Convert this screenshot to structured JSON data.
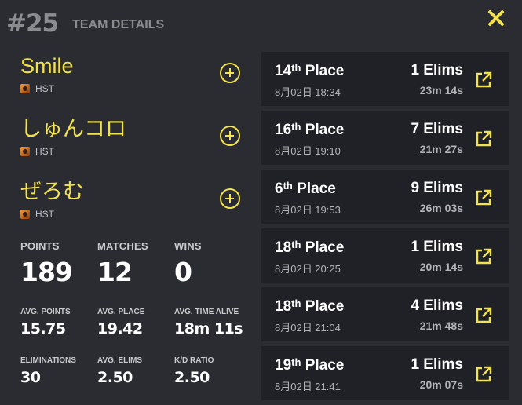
{
  "header": {
    "rank": "#25",
    "title": "TEAM DETAILS"
  },
  "colors": {
    "accent": "#f3e24f",
    "background": "#2a2c31",
    "card": "#1f2126",
    "muted": "#8a8c90"
  },
  "players": [
    {
      "name": "Smile",
      "tag": "HST",
      "tag_icon": "team-logo-icon"
    },
    {
      "name": "しゅんコロ",
      "tag": "HST",
      "tag_icon": "team-logo-icon"
    },
    {
      "name": "ぜろむ",
      "tag": "HST",
      "tag_icon": "team-logo-icon"
    }
  ],
  "stats": {
    "points_label": "POINTS",
    "points": "189",
    "matches_label": "MATCHES",
    "matches": "12",
    "wins_label": "WINS",
    "wins": "0",
    "avg_points_label": "AVG. POINTS",
    "avg_points": "15.75",
    "avg_place_label": "AVG. PLACE",
    "avg_place": "19.42",
    "avg_time_label": "AVG. TIME ALIVE",
    "avg_time": "18m 11s",
    "elims_label": "ELIMINATIONS",
    "elims": "30",
    "avg_elims_label": "AVG. ELIMS",
    "avg_elims": "2.50",
    "kd_label": "K/D RATIO",
    "kd": "2.50"
  },
  "matches": [
    {
      "place_num": "14",
      "place_suffix": "th",
      "place_word": "Place",
      "date": "8月02日 18:34",
      "elims": "1 Elims",
      "time": "23m 14s"
    },
    {
      "place_num": "16",
      "place_suffix": "th",
      "place_word": "Place",
      "date": "8月02日 19:10",
      "elims": "7 Elims",
      "time": "21m 27s"
    },
    {
      "place_num": "6",
      "place_suffix": "th",
      "place_word": "Place",
      "date": "8月02日 19:53",
      "elims": "9 Elims",
      "time": "26m 03s"
    },
    {
      "place_num": "18",
      "place_suffix": "th",
      "place_word": "Place",
      "date": "8月02日 20:25",
      "elims": "1 Elims",
      "time": "20m 14s"
    },
    {
      "place_num": "18",
      "place_suffix": "th",
      "place_word": "Place",
      "date": "8月02日 21:04",
      "elims": "4 Elims",
      "time": "21m 48s"
    },
    {
      "place_num": "19",
      "place_suffix": "th",
      "place_word": "Place",
      "date": "8月02日 21:41",
      "elims": "1 Elims",
      "time": "20m 07s"
    }
  ]
}
